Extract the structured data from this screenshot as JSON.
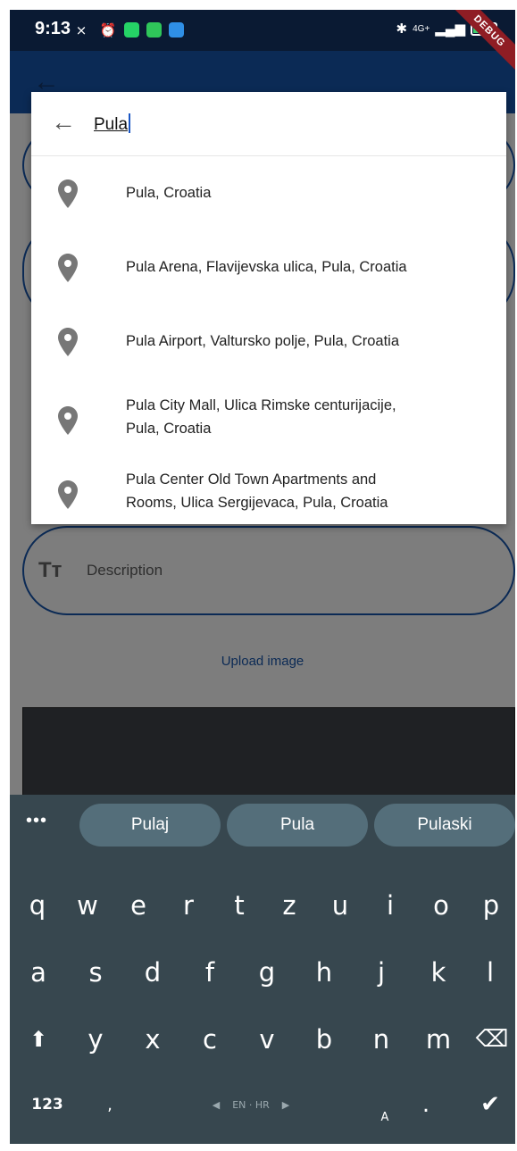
{
  "status_bar": {
    "time": "9:13",
    "network": "4G+",
    "debug_banner": "DEBUG"
  },
  "search": {
    "query": "Pula"
  },
  "suggestions": [
    {
      "line1": "Pula, Croatia",
      "line2": ""
    },
    {
      "line1": "Pula Arena, Flavijevska ulica, Pula, Croatia",
      "line2": ""
    },
    {
      "line1": "Pula Airport, Valtursko polje, Pula, Croatia",
      "line2": ""
    },
    {
      "line1": "Pula City Mall, Ulica Rimske centurijacije,",
      "line2": "Pula, Croatia"
    },
    {
      "line1": "Pula Center Old Town Apartments and",
      "line2": "Rooms, Ulica Sergijevaca, Pula, Croatia"
    }
  ],
  "form": {
    "description_icon": "Tт",
    "description_label": "Description",
    "upload_label": "Upload image"
  },
  "keyboard": {
    "more": "•••",
    "suggestions": [
      "Pulaj",
      "Pula",
      "Pulaski"
    ],
    "row1": [
      "q",
      "w",
      "e",
      "r",
      "t",
      "z",
      "u",
      "i",
      "o",
      "p"
    ],
    "row2": [
      "a",
      "s",
      "d",
      "f",
      "g",
      "h",
      "j",
      "k",
      "l"
    ],
    "row3": [
      "y",
      "x",
      "c",
      "v",
      "b",
      "n",
      "m"
    ],
    "numbers_key": "123",
    "comma_key": ",",
    "language": "EN · HR",
    "lang_switch": "A",
    "period_key": ".",
    "shift_glyph": "⬆",
    "backspace_glyph": "⌫",
    "enter_glyph": "✔"
  },
  "colors": {
    "status_bar": "#0a1a33",
    "app_bar": "#0b2a55",
    "accent": "#0b2a55",
    "keyboard_bg": "#37474f",
    "chip_bg": "#546e7a",
    "debug": "#8f1d24"
  },
  "icons": {
    "back": "arrow-left-icon",
    "location": "location-pin-icon",
    "text_field": "text-format-icon"
  }
}
